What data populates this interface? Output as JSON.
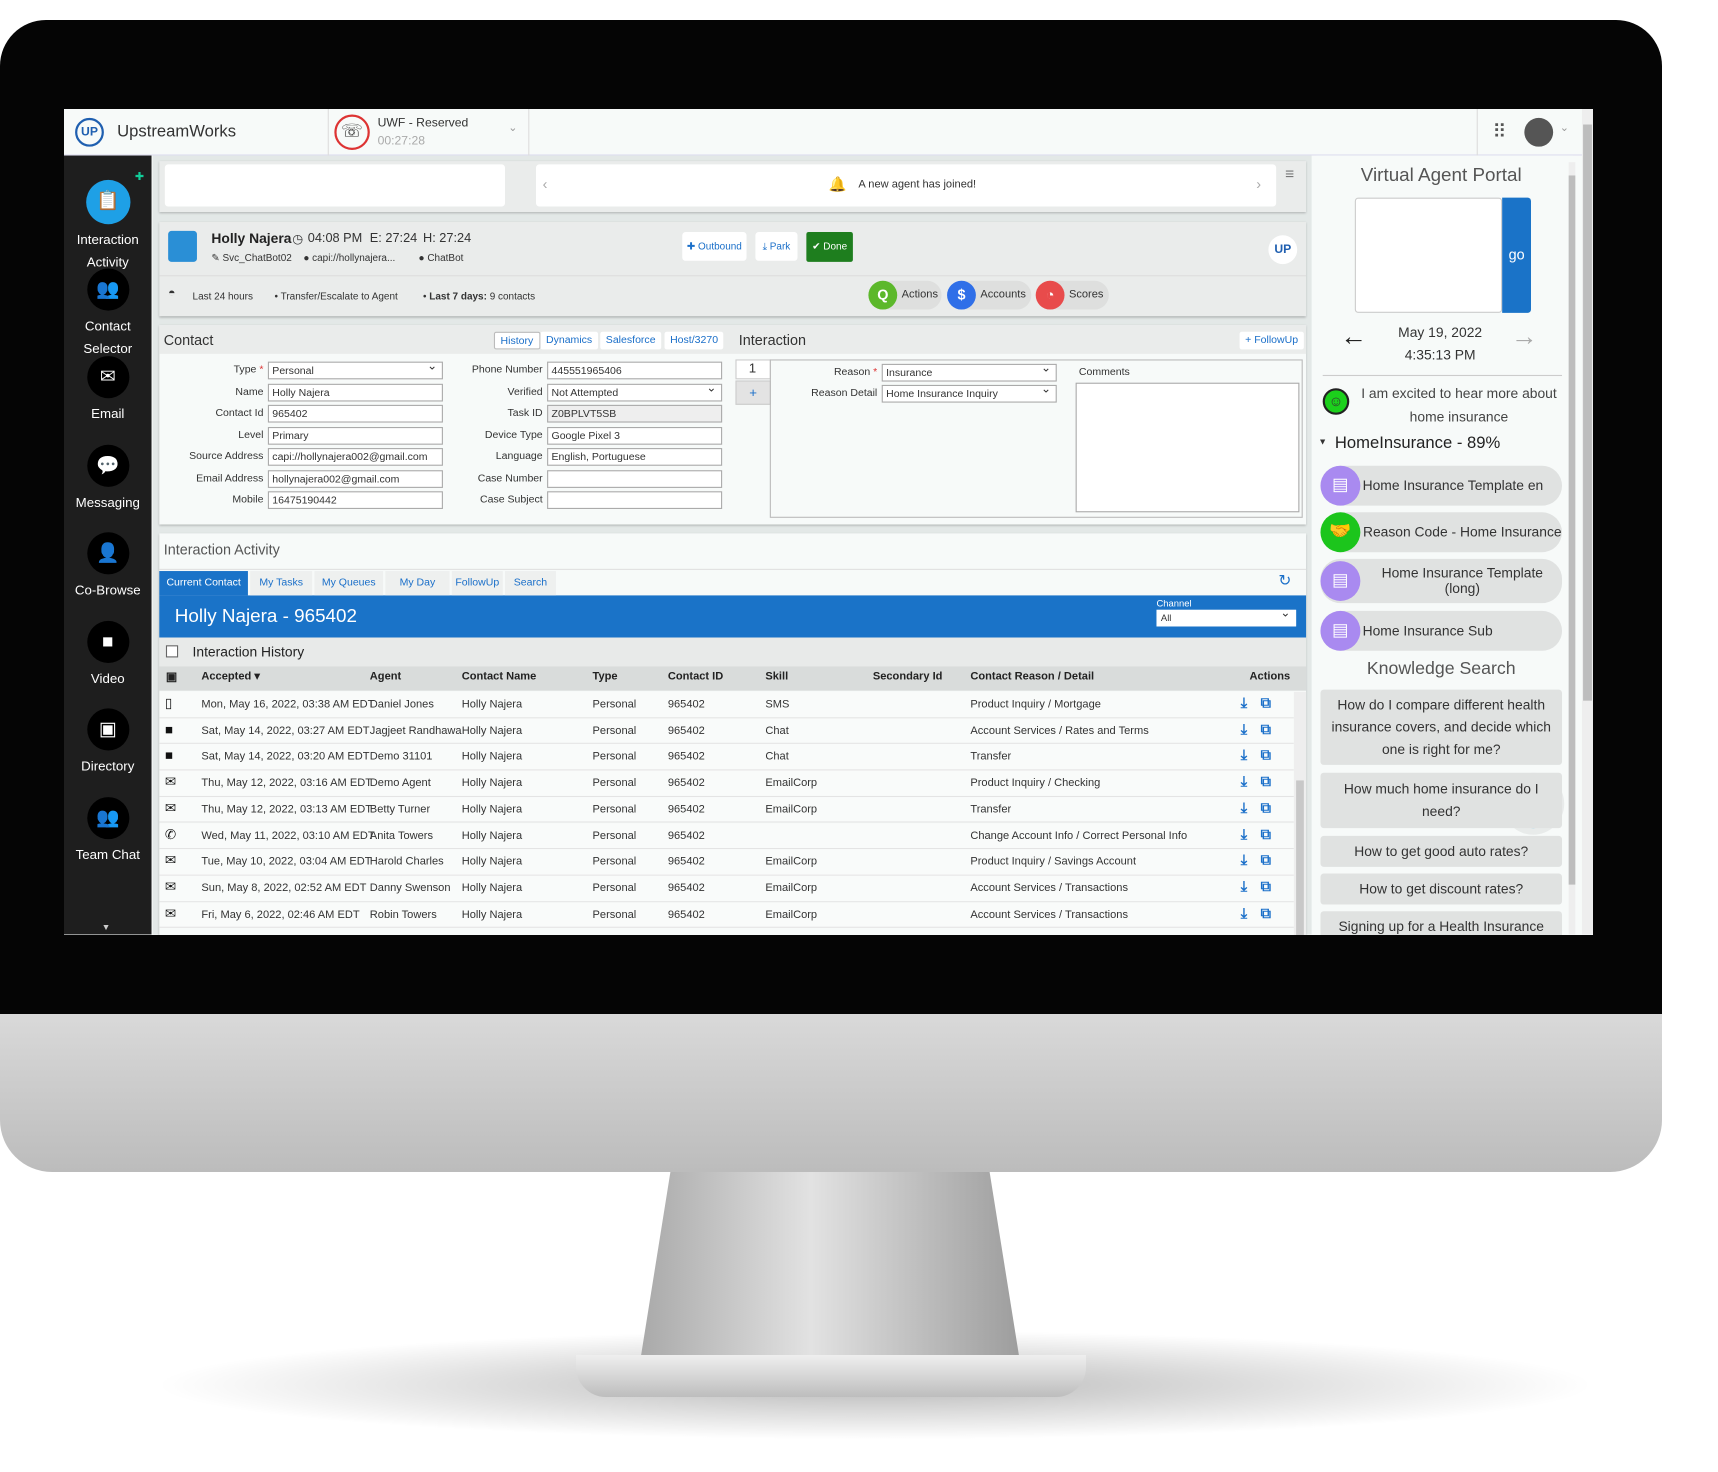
{
  "app": {
    "brand": "UpstreamWorks",
    "logo_text": "UP",
    "status": "UWF - Reserved",
    "timer": "00:27:28"
  },
  "colors": {
    "accent": "#1a73c8",
    "done": "#1e7e1e",
    "sidebar": "#1e1e1e",
    "actions": "#5cb82b",
    "accounts": "#2f6fe8",
    "scores": "#e84b4b",
    "template": "#a98af0",
    "reason": "#1cc51c"
  },
  "sidebar": {
    "items": [
      {
        "label1": "Interaction",
        "label2": "Activity",
        "icon": "clipboard-icon"
      },
      {
        "label1": "Contact",
        "label2": "Selector",
        "icon": "users-icon"
      },
      {
        "label1": "Email",
        "label2": "",
        "icon": "email-icon"
      },
      {
        "label1": "Messaging",
        "label2": "",
        "icon": "chat-icon"
      },
      {
        "label1": "Co-Browse",
        "label2": "",
        "icon": "cobrowse-icon"
      },
      {
        "label1": "Video",
        "label2": "",
        "icon": "video-icon"
      },
      {
        "label1": "Directory",
        "label2": "",
        "icon": "directory-icon"
      },
      {
        "label1": "Team Chat",
        "label2": "",
        "icon": "team-icon"
      }
    ]
  },
  "notification": "A new agent has joined!",
  "contact_header": {
    "name": "Holly Najera",
    "time": "04:08 PM",
    "e": "E: 27:24",
    "h": "H: 27:24",
    "bot": "Svc_ChatBot02",
    "address": "capi://hollynajera...",
    "channel": "ChatBot",
    "last24": "Last 24 hours",
    "transfer": "Transfer/Escalate to Agent",
    "last7_label": "Last 7 days:",
    "last7_value": "9 contacts",
    "outbound": "Outbound",
    "park": "Park",
    "done": "Done",
    "actions": "Actions",
    "accounts": "Accounts",
    "scores": "Scores"
  },
  "contact": {
    "title": "Contact",
    "tabs": [
      "History",
      "Dynamics",
      "Salesforce",
      "Host/3270"
    ],
    "left": [
      {
        "label": "Type",
        "value": "Personal",
        "select": true,
        "req": true
      },
      {
        "label": "Name",
        "value": "Holly Najera"
      },
      {
        "label": "Contact Id",
        "value": "965402"
      },
      {
        "label": "Level",
        "value": "Primary"
      },
      {
        "label": "Source Address",
        "value": "capi://hollynajera002@gmail.com"
      },
      {
        "label": "Email Address",
        "value": "hollynajera002@gmail.com"
      },
      {
        "label": "Mobile",
        "value": "16475190442"
      }
    ],
    "right": [
      {
        "label": "Phone Number",
        "value": "445551965406"
      },
      {
        "label": "Verified",
        "value": "Not Attempted",
        "select": true
      },
      {
        "label": "Task ID",
        "value": "Z0BPLVT5SB",
        "readonly": true
      },
      {
        "label": "Device Type",
        "value": "Google Pixel 3"
      },
      {
        "label": "Language",
        "value": "English, Portuguese"
      },
      {
        "label": "Case Number",
        "value": ""
      },
      {
        "label": "Case Subject",
        "value": ""
      }
    ]
  },
  "interaction": {
    "title": "Interaction",
    "followup": "+ FollowUp",
    "index": "1",
    "add": "+",
    "reason_label": "Reason",
    "reason": "Insurance",
    "detail_label": "Reason Detail",
    "detail": "Home Insurance Inquiry",
    "comments_label": "Comments",
    "comments": ""
  },
  "activity": {
    "title": "Interaction Activity",
    "tabs": [
      "Current Contact",
      "My Tasks",
      "My Queues",
      "My Day",
      "FollowUp",
      "Search"
    ],
    "banner": "Holly Najera - 965402",
    "channel_label": "Channel",
    "channel": "All",
    "history": "Interaction History",
    "columns": [
      "Accepted ▾",
      "Agent",
      "Contact Name",
      "Type",
      "Contact ID",
      "Skill",
      "Secondary Id",
      "Contact Reason / Detail",
      "Actions"
    ],
    "rows": [
      {
        "icon": "mobile-icon",
        "accepted": "Mon, May 16, 2022, 03:38 AM EDT",
        "agent": "Daniel Jones",
        "name": "Holly Najera",
        "type": "Personal",
        "id": "965402",
        "skill": "SMS",
        "secondary": "",
        "reason": "Product Inquiry / Mortgage"
      },
      {
        "icon": "chat-icon",
        "accepted": "Sat, May 14, 2022, 03:27 AM EDT",
        "agent": "Jagjeet Randhawa",
        "name": "Holly Najera",
        "type": "Personal",
        "id": "965402",
        "skill": "Chat",
        "secondary": "",
        "reason": "Account Services / Rates and Terms"
      },
      {
        "icon": "chat-icon",
        "accepted": "Sat, May 14, 2022, 03:20 AM EDT",
        "agent": "Demo 31101",
        "name": "Holly Najera",
        "type": "Personal",
        "id": "965402",
        "skill": "Chat",
        "secondary": "",
        "reason": "Transfer"
      },
      {
        "icon": "email-icon",
        "accepted": "Thu, May 12, 2022, 03:16 AM EDT",
        "agent": "Demo Agent",
        "name": "Holly Najera",
        "type": "Personal",
        "id": "965402",
        "skill": "EmailCorp",
        "secondary": "",
        "reason": "Product Inquiry / Checking"
      },
      {
        "icon": "email-icon",
        "accepted": "Thu, May 12, 2022, 03:13 AM EDT",
        "agent": "Betty Turner",
        "name": "Holly Najera",
        "type": "Personal",
        "id": "965402",
        "skill": "EmailCorp",
        "secondary": "",
        "reason": "Transfer"
      },
      {
        "icon": "phone-icon",
        "accepted": "Wed, May 11, 2022, 03:10 AM EDT",
        "agent": "Anita Towers",
        "name": "Holly Najera",
        "type": "Personal",
        "id": "965402",
        "skill": "",
        "secondary": "",
        "reason": "Change Account Info / Correct Personal Info"
      },
      {
        "icon": "email-icon",
        "accepted": "Tue, May 10, 2022, 03:04 AM EDT",
        "agent": "Harold Charles",
        "name": "Holly Najera",
        "type": "Personal",
        "id": "965402",
        "skill": "EmailCorp",
        "secondary": "",
        "reason": "Product Inquiry / Savings Account"
      },
      {
        "icon": "email-icon",
        "accepted": "Sun, May 8, 2022, 02:52 AM EDT",
        "agent": "Danny Swenson",
        "name": "Holly Najera",
        "type": "Personal",
        "id": "965402",
        "skill": "EmailCorp",
        "secondary": "",
        "reason": "Account Services / Transactions"
      },
      {
        "icon": "email-icon",
        "accepted": "Fri, May 6, 2022, 02:46 AM EDT",
        "agent": "Robin Towers",
        "name": "Holly Najera",
        "type": "Personal",
        "id": "965402",
        "skill": "EmailCorp",
        "secondary": "",
        "reason": "Account Services / Transactions"
      }
    ]
  },
  "portal": {
    "title": "Virtual Agent Portal",
    "go": "go",
    "input": "",
    "date": "May 19, 2022",
    "time": "4:35:13 PM",
    "message": "I am excited to hear more about home insurance",
    "intent": "HomeInsurance - 89%",
    "chips": [
      {
        "label": "Home Insurance Template en",
        "kind": "template"
      },
      {
        "label": "Reason Code - Home Insurance",
        "kind": "reason"
      },
      {
        "label": "Home Insurance Template (long)",
        "kind": "template"
      },
      {
        "label": "Home Insurance Sub",
        "kind": "template"
      }
    ],
    "knowledge_title": "Knowledge Search",
    "knowledge": [
      "How do I compare different health insurance covers, and decide which one is right for me?",
      "How much home insurance do I need?",
      "How to get good auto rates?",
      "How to get discount rates?",
      "Signing up for a Health Insurance"
    ]
  }
}
